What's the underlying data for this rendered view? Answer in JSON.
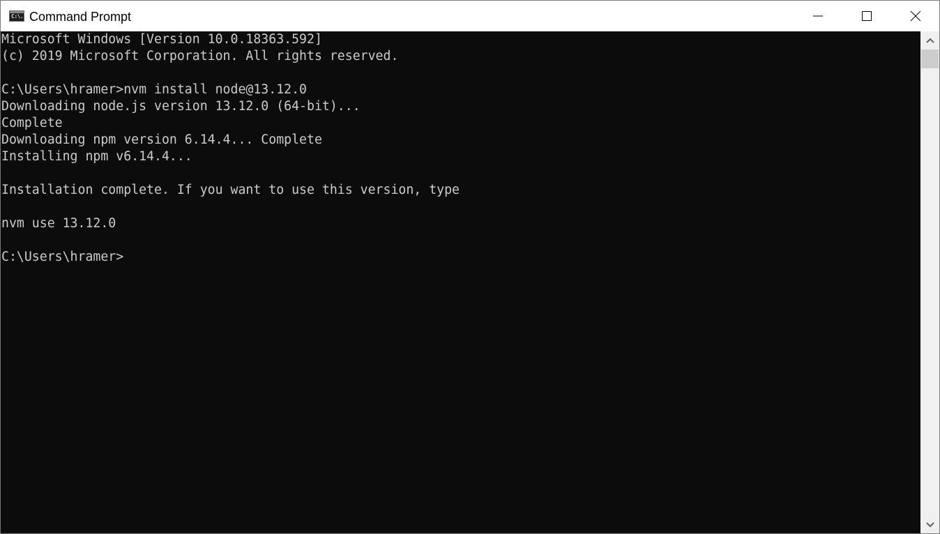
{
  "window": {
    "title": "Command Prompt",
    "icon": "cmd-icon",
    "icon_text": "C:\\.",
    "controls": {
      "minimize": "minimize-icon",
      "maximize": "maximize-icon",
      "close": "close-icon"
    }
  },
  "console": {
    "background": "#0c0c0c",
    "foreground": "#cccccc",
    "lines": [
      "Microsoft Windows [Version 10.0.18363.592]",
      "(c) 2019 Microsoft Corporation. All rights reserved.",
      "",
      "C:\\Users\\hramer>nvm install node@13.12.0",
      "Downloading node.js version 13.12.0 (64-bit)...",
      "Complete",
      "Downloading npm version 6.14.4... Complete",
      "Installing npm v6.14.4...",
      "",
      "Installation complete. If you want to use this version, type",
      "",
      "nvm use 13.12.0",
      "",
      "C:\\Users\\hramer>"
    ]
  },
  "scrollbar": {
    "up": "chevron-up-icon",
    "down": "chevron-down-icon"
  }
}
